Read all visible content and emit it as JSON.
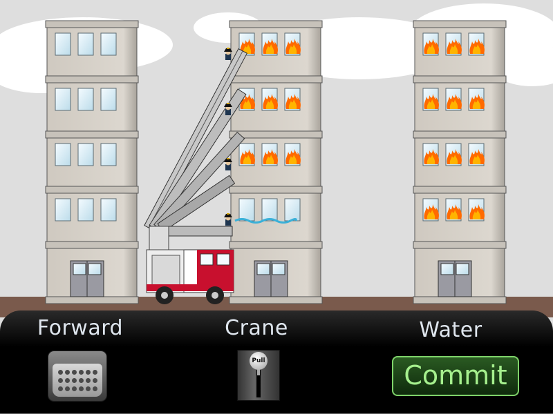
{
  "controls": {
    "forward": {
      "label": "Forward",
      "icon": "pedal-icon"
    },
    "crane": {
      "label": "Crane",
      "icon": "lever-icon",
      "knob_label": "Pull"
    },
    "water": {
      "label": "Water",
      "button_label": "Commit"
    }
  },
  "colors": {
    "sky": "#dedede",
    "ground": "#7a5a4c",
    "building_wall": "#d5d0c8",
    "fire": "#ff7a00",
    "truck_red": "#c8102e",
    "commit_text": "#a6f08e"
  },
  "scene": {
    "buildings": 3,
    "burning_windows": "many"
  }
}
